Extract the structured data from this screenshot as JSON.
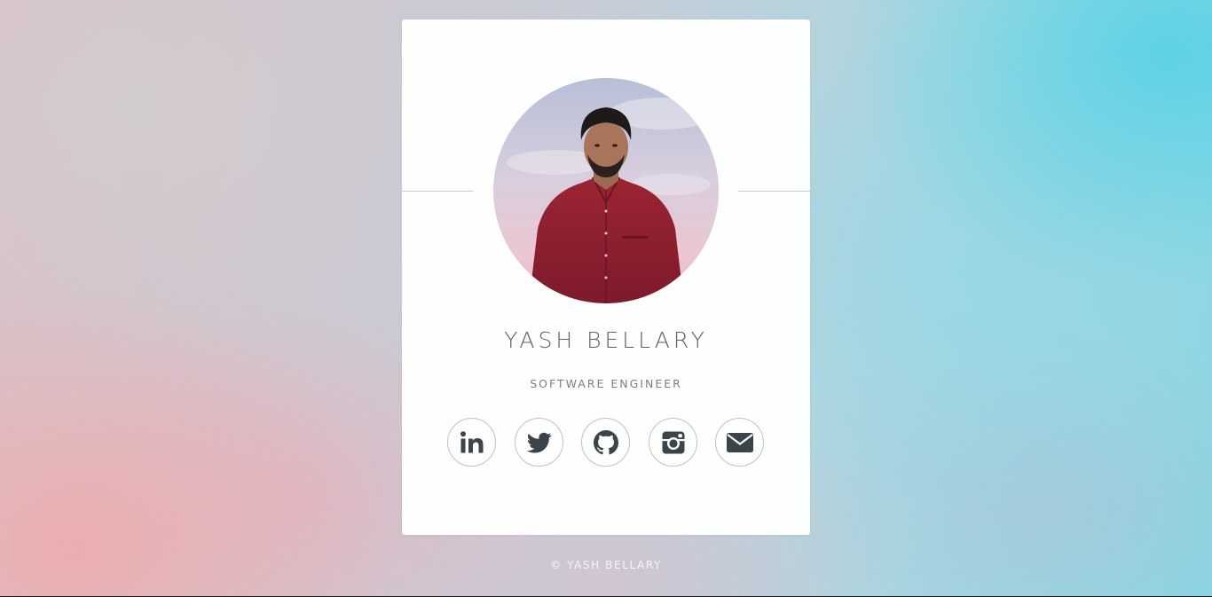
{
  "profile": {
    "name": "YASH BELLARY",
    "title": "SOFTWARE ENGINEER"
  },
  "social_links": [
    {
      "icon": "linkedin-icon"
    },
    {
      "icon": "twitter-icon"
    },
    {
      "icon": "github-icon"
    },
    {
      "icon": "instagram-icon"
    },
    {
      "icon": "email-icon"
    }
  ],
  "footer": {
    "text": "© YASH BELLARY"
  },
  "colors": {
    "card_background": "#ffffff",
    "text_primary": "#5d6166",
    "text_secondary": "#7b7f84",
    "icon_color": "#3b4449",
    "icon_border": "#bfc3c6",
    "footer_text": "#f5f6f8"
  }
}
